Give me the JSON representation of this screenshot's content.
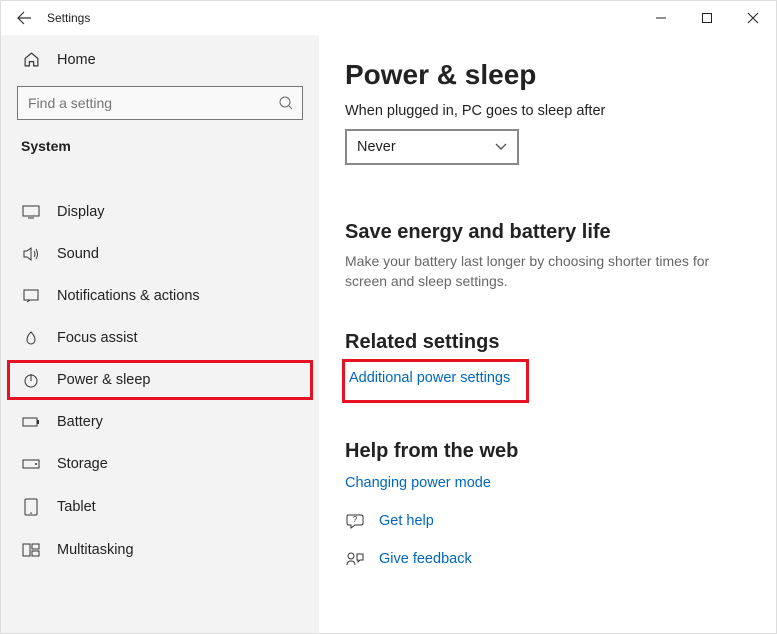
{
  "titlebar": {
    "title": "Settings"
  },
  "sidebar": {
    "home_label": "Home",
    "search_placeholder": "Find a setting",
    "section_label": "System",
    "items": [
      {
        "label": "Display"
      },
      {
        "label": "Sound"
      },
      {
        "label": "Notifications & actions"
      },
      {
        "label": "Focus assist"
      },
      {
        "label": "Power & sleep"
      },
      {
        "label": "Battery"
      },
      {
        "label": "Storage"
      },
      {
        "label": "Tablet"
      },
      {
        "label": "Multitasking"
      }
    ]
  },
  "main": {
    "heading": "Power & sleep",
    "plugged_label": "When plugged in, PC goes to sleep after",
    "select_value": "Never",
    "save_heading": "Save energy and battery life",
    "save_body": "Make your battery last longer by choosing shorter times for screen and sleep settings.",
    "related_heading": "Related settings",
    "related_link": "Additional power settings",
    "help_heading": "Help from the web",
    "help_link": "Changing power mode",
    "get_help": "Get help",
    "give_feedback": "Give feedback"
  }
}
